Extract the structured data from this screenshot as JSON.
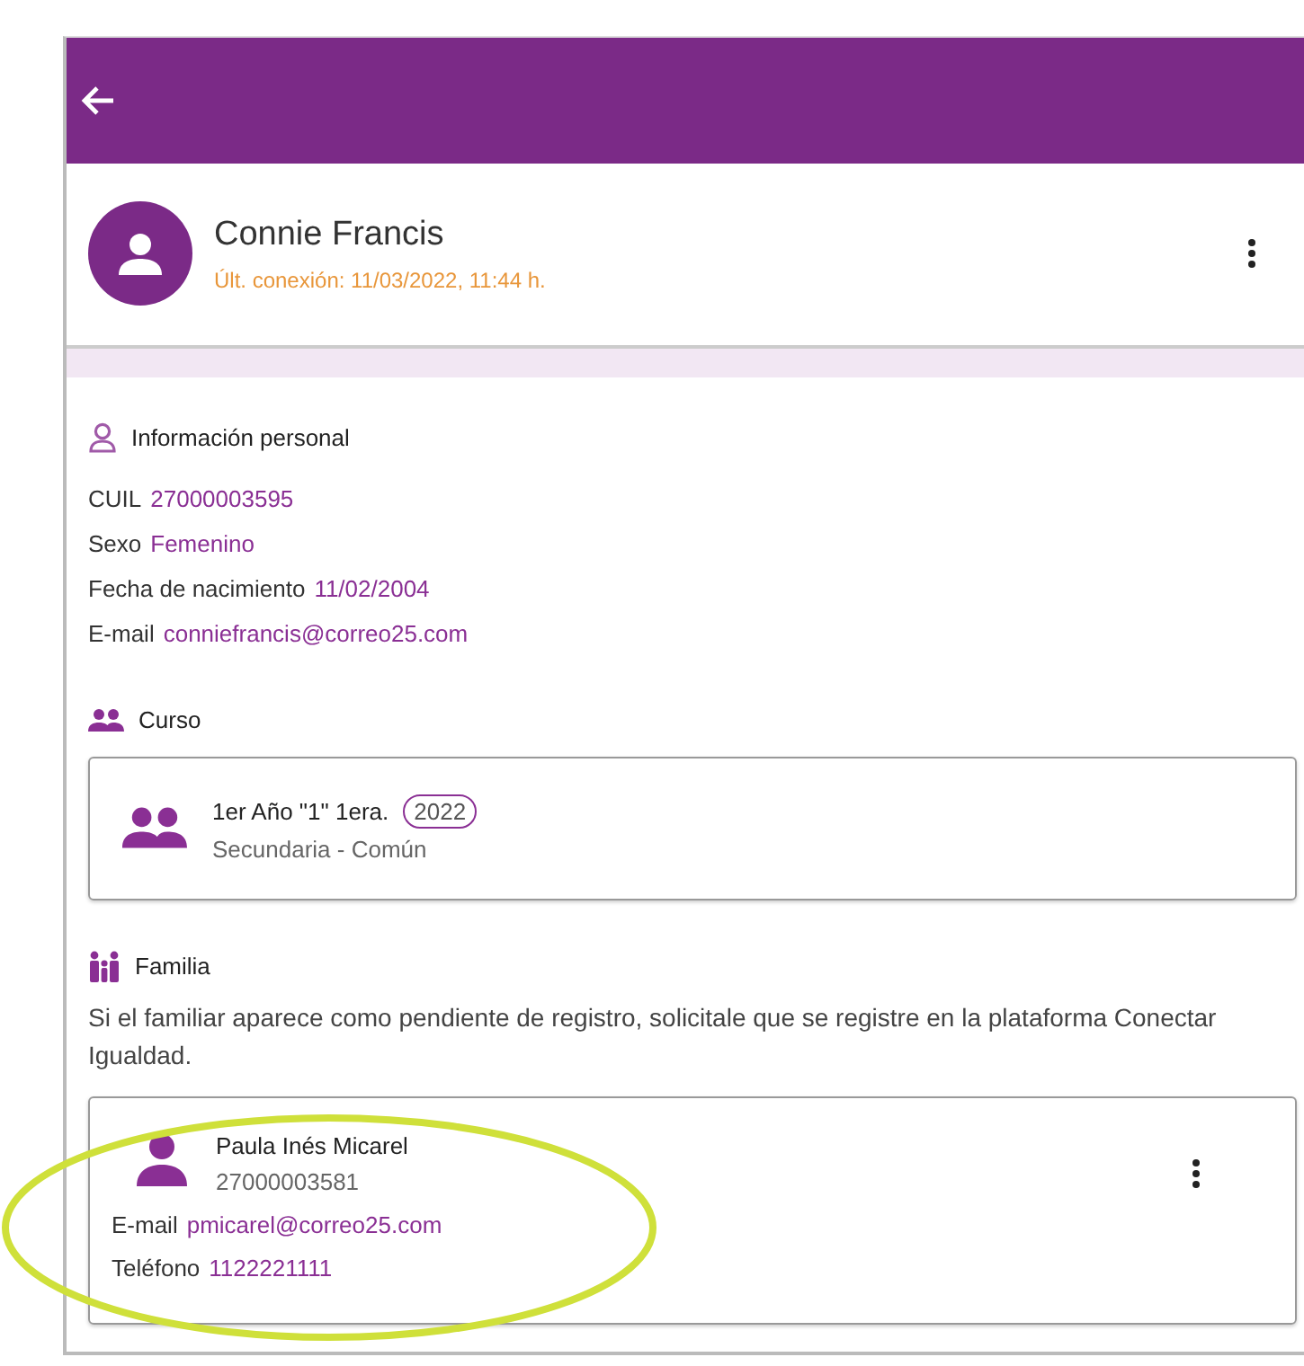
{
  "profile": {
    "name": "Connie Francis",
    "last_connection": "Últ. conexión: 11/03/2022, 11:44 h."
  },
  "personal_info": {
    "title": "Información personal",
    "fields": [
      {
        "label": "CUIL",
        "value": "27000003595"
      },
      {
        "label": "Sexo",
        "value": "Femenino"
      },
      {
        "label": "Fecha de nacimiento",
        "value": "11/02/2004"
      },
      {
        "label": "E-mail",
        "value": "conniefrancis@correo25.com"
      }
    ]
  },
  "course": {
    "title": "Curso",
    "name": "1er Año \"1\" 1era.",
    "year": "2022",
    "level": "Secundaria - Común"
  },
  "family": {
    "title": "Familia",
    "notice": "Si el familiar aparece como pendiente de registro, solicitale que se registre en la plataforma Conectar Igualdad.",
    "members": [
      {
        "name": "Paula Inés Micarel",
        "cuil": "27000003581",
        "fields": [
          {
            "label": "E-mail",
            "value": "pmicarel@correo25.com"
          },
          {
            "label": "Teléfono",
            "value": "1122221111"
          }
        ]
      }
    ]
  }
}
